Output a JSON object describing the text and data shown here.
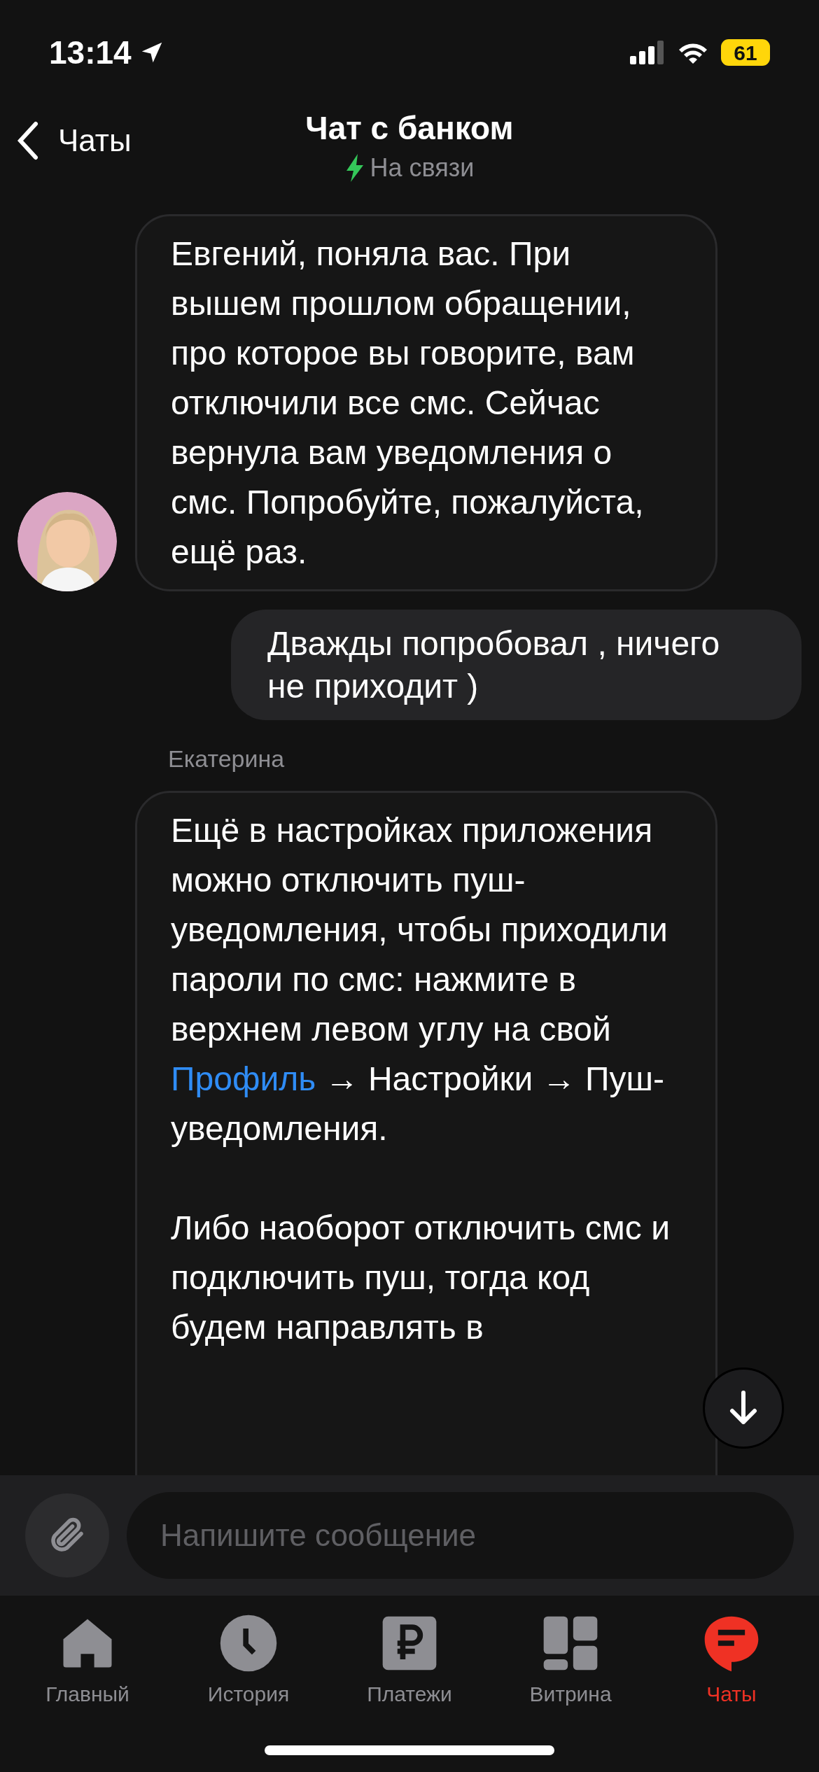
{
  "status_bar": {
    "time": "13:14",
    "battery": "61"
  },
  "header": {
    "back": "Чаты",
    "title": "Чат с банком",
    "status": "На связи"
  },
  "messages": [
    {
      "kind": "incoming",
      "avatar": true,
      "paragraphs": [
        {
          "text": "Евгений, поняла вас. При вышем прошлом обращении, про которое вы говорите, вам отключили все смс. Сейчас вернула вам уведомления о смс. Попробуйте, пожалуйста, ещё раз."
        }
      ]
    },
    {
      "kind": "outgoing",
      "paragraphs": [
        {
          "text": "Дважды попробовал , ничего не приходит )"
        }
      ]
    },
    {
      "kind": "incoming",
      "sender": "Екатерина",
      "avatar": false,
      "paragraphs": [
        {
          "text": "Ещё в настройках приложения можно отключить пуш-уведомления, чтобы приходили пароли по смс: нажмите в верхнем левом углу на свой",
          "link": "Профиль",
          "after": "→ Настройки → Пуш-уведомления."
        },
        {
          "text": "Либо наоборот отключить смс и подключить пуш, тогда код будем направлять в"
        }
      ]
    }
  ],
  "composer": {
    "placeholder": "Напишите сообщение"
  },
  "tabs": [
    {
      "label": "Главный",
      "selected": false
    },
    {
      "label": "История",
      "selected": false
    },
    {
      "label": "Платежи",
      "selected": false
    },
    {
      "label": "Витрина",
      "selected": false
    },
    {
      "label": "Чаты",
      "selected": true
    }
  ]
}
